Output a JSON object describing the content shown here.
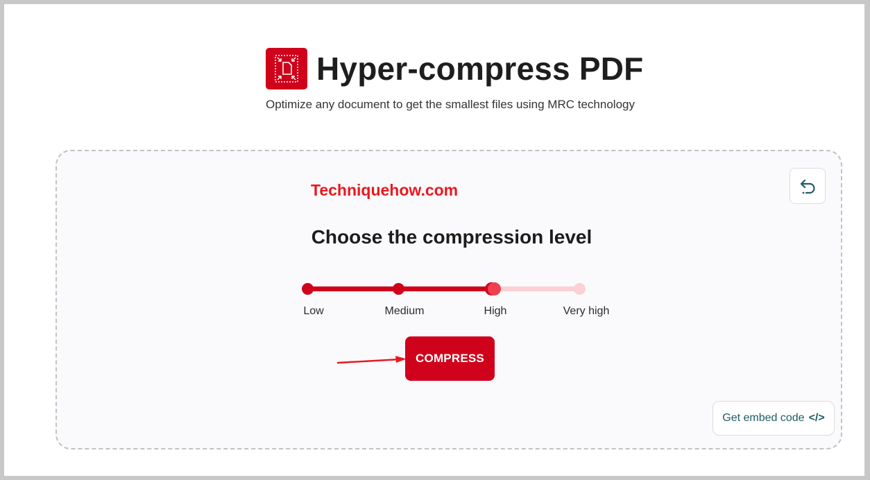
{
  "header": {
    "title": "Hyper-compress PDF",
    "subtitle": "Optimize any document to get the smallest files using MRC technology",
    "logo_icon": "compress-pdf-icon"
  },
  "card": {
    "watermark": "Techniquehow.com",
    "heading": "Choose the compression level",
    "undo_icon": "undo-icon",
    "levels": [
      "Low",
      "Medium",
      "High",
      "Very high"
    ],
    "selected_level": "High",
    "compress_label": "COMPRESS",
    "embed_label": "Get embed code",
    "embed_icon": "code-icon",
    "embed_icon_glyph": "</>"
  },
  "colors": {
    "brand": "#d0021b",
    "track_light": "#fcd0d4",
    "watermark": "#e8191f",
    "link_teal": "#1d5c63"
  }
}
